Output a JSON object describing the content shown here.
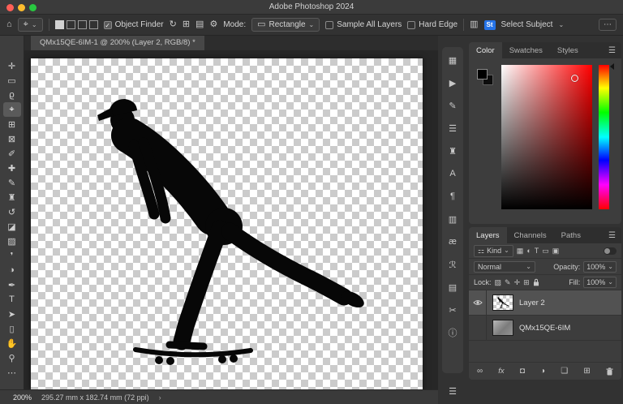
{
  "titlebar": {
    "title": "Adobe Photoshop 2024"
  },
  "ui": {
    "caret_down": "⌄",
    "check": "✓",
    "menu": "☰",
    "chevron_right": "›"
  },
  "colors": {
    "accent_blue": "#2573e8",
    "foreground": "#000000",
    "hue": "#ff0000"
  },
  "options": {
    "home_glyph": "⌂",
    "tool_preview_glyph": "⌖",
    "object_finder_label": "Object Finder",
    "refresh_glyph": "↻",
    "show_all_glyph": "⊞",
    "layers_view_glyph": "▤",
    "gear_glyph": "⚙",
    "mode_label": "Mode:",
    "mode_icon_glyph": "▭",
    "mode_value": "Rectangle",
    "sample_all_layers_label": "Sample All Layers",
    "hard_edge_label": "Hard Edge",
    "device_icon_glyph": "▥",
    "device_badge": "St",
    "select_subject_label": "Select Subject",
    "more_label": "⋯"
  },
  "document": {
    "tab_title": "QMx15QE-6IM-1 @ 200% (Layer 2, RGB/8) *"
  },
  "toolbar": {
    "tools": [
      {
        "name": "move-tool",
        "glyph": "✛"
      },
      {
        "name": "marquee-tool",
        "glyph": "▭"
      },
      {
        "name": "lasso-tool",
        "glyph": "ϱ"
      },
      {
        "name": "object-selection-tool",
        "glyph": "⌖"
      },
      {
        "name": "crop-tool",
        "glyph": "⊞"
      },
      {
        "name": "frame-tool",
        "glyph": "⊠"
      },
      {
        "name": "eyedropper-tool",
        "glyph": "✐"
      },
      {
        "name": "healing-brush-tool",
        "glyph": "✚"
      },
      {
        "name": "brush-tool",
        "glyph": "✎"
      },
      {
        "name": "clone-stamp-tool",
        "glyph": "♜"
      },
      {
        "name": "history-brush-tool",
        "glyph": "↺"
      },
      {
        "name": "eraser-tool",
        "glyph": "◪"
      },
      {
        "name": "gradient-tool",
        "glyph": "▨"
      },
      {
        "name": "blur-tool",
        "glyph": "❜"
      },
      {
        "name": "dodge-tool",
        "glyph": "◑"
      },
      {
        "name": "pen-tool",
        "glyph": "✒"
      },
      {
        "name": "type-tool",
        "glyph": "T"
      },
      {
        "name": "path-selection-tool",
        "glyph": "➤"
      },
      {
        "name": "shape-tool",
        "glyph": "▯"
      },
      {
        "name": "hand-tool",
        "glyph": "✋"
      },
      {
        "name": "zoom-tool",
        "glyph": "⚲"
      },
      {
        "name": "edit-toolbar-button",
        "glyph": "⋯"
      }
    ]
  },
  "panel_strip": {
    "icons": [
      {
        "name": "libraries-panel-icon",
        "glyph": "▦"
      },
      {
        "name": "actions-panel-icon",
        "glyph": "▶"
      },
      {
        "name": "brush-settings-panel-icon",
        "glyph": "✎"
      },
      {
        "name": "properties-panel-icon",
        "glyph": "☰"
      },
      {
        "name": "clone-source-panel-icon",
        "glyph": "♜"
      },
      {
        "name": "character-panel-icon",
        "glyph": "A"
      },
      {
        "name": "paragraph-panel-icon",
        "glyph": "¶"
      },
      {
        "name": "layer-comps-panel-icon",
        "glyph": "▥"
      },
      {
        "name": "character-styles-panel-icon",
        "glyph": "æ"
      },
      {
        "name": "paragraph-styles-panel-icon",
        "glyph": "ℛ"
      },
      {
        "name": "timeline-panel-icon",
        "glyph": "▤"
      },
      {
        "name": "scissors-panel-icon",
        "glyph": "✂"
      },
      {
        "name": "info-panel-icon",
        "glyph": "ⓘ"
      }
    ],
    "bottom_icon_glyph": "☰"
  },
  "color_panel": {
    "tabs": [
      {
        "label": "Color"
      },
      {
        "label": "Swatches"
      },
      {
        "label": "Styles"
      }
    ]
  },
  "layers_panel": {
    "tabs": [
      {
        "label": "Layers"
      },
      {
        "label": "Channels"
      },
      {
        "label": "Paths"
      }
    ],
    "filter": {
      "kind_icon": "⚏",
      "kind_label": "Kind",
      "icons": [
        {
          "name": "filter-pixel-layers-icon",
          "glyph": "▦"
        },
        {
          "name": "filter-adjustment-layers-icon",
          "glyph": "◐"
        },
        {
          "name": "filter-type-layers-icon",
          "glyph": "T"
        },
        {
          "name": "filter-shape-layers-icon",
          "glyph": "▭"
        },
        {
          "name": "filter-smart-objects-icon",
          "glyph": "▣"
        }
      ]
    },
    "blend_mode": "Normal",
    "opacity_label": "Opacity:",
    "opacity_value": "100%",
    "lock_label": "Lock:",
    "lock_icons": [
      {
        "name": "lock-transparent-pixels-icon",
        "glyph": "▨"
      },
      {
        "name": "lock-image-pixels-icon",
        "glyph": "✎"
      },
      {
        "name": "lock-position-icon",
        "glyph": "✛"
      },
      {
        "name": "lock-artboard-icon",
        "glyph": "⊞"
      }
    ],
    "fill_label": "Fill:",
    "fill_value": "100%",
    "layers": [
      {
        "name": "Layer 2",
        "visible": true,
        "selected": true
      },
      {
        "name": "QMx15QE-6IM",
        "visible": false,
        "selected": false
      }
    ],
    "bottom_icons": {
      "link_glyph": "∞",
      "fx_label": "fx",
      "mask_glyph": "◘",
      "adjustment_glyph": "◑",
      "group_glyph": "❏",
      "new_layer_glyph": "⊞"
    }
  },
  "statusbar": {
    "zoom": "200%",
    "dims": "295.27 mm x 182.74 mm (72 ppi)"
  }
}
